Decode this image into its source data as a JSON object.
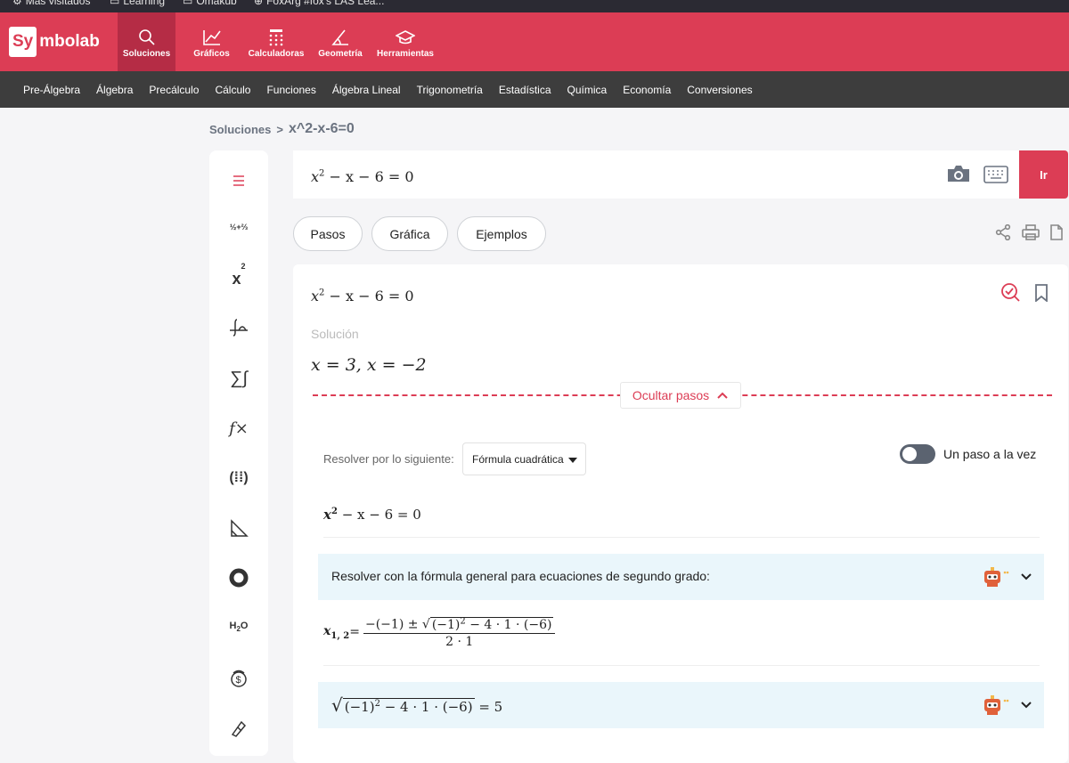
{
  "bookmarks": [
    {
      "icon": "gear-icon",
      "label": "Más visitados"
    },
    {
      "icon": "folder-icon",
      "label": "Learning"
    },
    {
      "icon": "folder-icon",
      "label": "Omakub"
    },
    {
      "icon": "globe-icon",
      "label": "FoxArg #fox's LAS Lea..."
    }
  ],
  "brand": {
    "logo_part1": "Sy",
    "logo_part2": "mbolab",
    "accent": "#dc3d55"
  },
  "topnav": [
    {
      "label": "Soluciones",
      "icon": "search-icon",
      "active": true
    },
    {
      "label": "Gráficos",
      "icon": "chart-icon"
    },
    {
      "label": "Calculadoras",
      "icon": "calculator-icon"
    },
    {
      "label": "Geometría",
      "icon": "angle-icon"
    },
    {
      "label": "Herramientas",
      "icon": "graduation-cap-icon"
    }
  ],
  "subnav": [
    "Pre-Álgebra",
    "Álgebra",
    "Precálculo",
    "Cálculo",
    "Funciones",
    "Álgebra Lineal",
    "Trigonometría",
    "Estadística",
    "Química",
    "Economía",
    "Conversiones"
  ],
  "breadcrumb": {
    "root": "Soluciones",
    "sep": ">",
    "current": "x^2-x-6=0"
  },
  "sidebar": [
    "menu-icon",
    "fractions-icon",
    "exponent-icon",
    "integral-icon",
    "sigma-icon",
    "function-icon",
    "matrix-icon",
    "triangle-pi-icon",
    "chart-donut-icon",
    "chemistry-icon",
    "finance-icon",
    "convert-icon"
  ],
  "input": {
    "x": "x",
    "exp": "2",
    "rest": " − x − 6 = 0",
    "go_label": "Ir"
  },
  "tabs": [
    "Pasos",
    "Gráfica",
    "Ejemplos"
  ],
  "result": {
    "question_x": "x",
    "question_exp": "2",
    "question_rest": " − x − 6 = 0",
    "solution_label": "Solución",
    "solution": "x = 3, x =  −2",
    "hide_steps": "Ocultar pasos"
  },
  "steps": {
    "solve_by_label": "Resolver por lo siguiente:",
    "method": "Fórmula cuadrática",
    "toggle_label": "Un paso a la vez",
    "toggle_on": false,
    "eq_x": "x",
    "eq_exp": "2",
    "eq_rest": " − x − 6 = 0",
    "box1_text": "Resolver con la fórmula general para ecuaciones de segundo grado:",
    "formula_lhs": "x",
    "formula_sub": "1, 2",
    "formula_eq": " =",
    "formula_num_a": "−(−1) ± √",
    "formula_num_b": "(−1)",
    "formula_num_b_exp": "2",
    "formula_num_c": " − 4 · 1 · (−6)",
    "formula_den": "2 · 1",
    "box2_sqrt": "√",
    "box2_inner": "(−1)",
    "box2_exp": "2",
    "box2_rest": " − 4 · 1 · (−6)",
    "box2_result": " = 5"
  }
}
